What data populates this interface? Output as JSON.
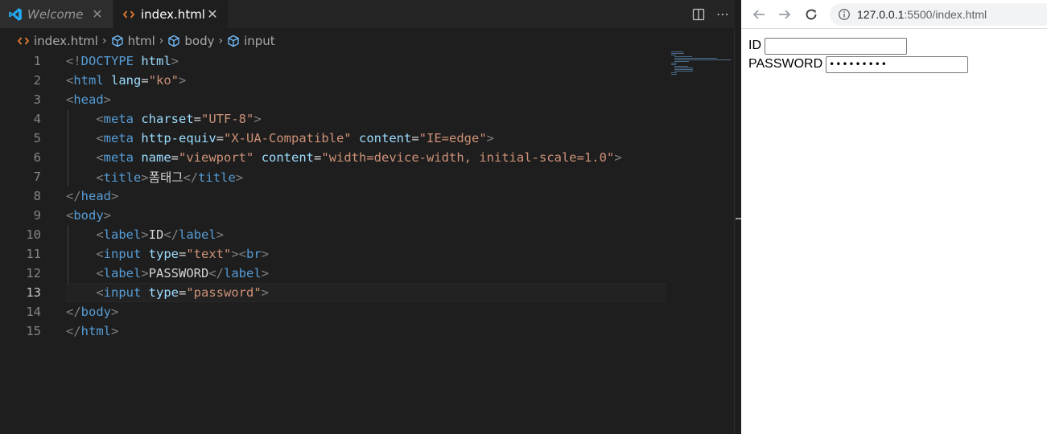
{
  "editor": {
    "tabs": [
      {
        "label": "Welcome",
        "active": false
      },
      {
        "label": "index.html",
        "active": true
      }
    ],
    "breadcrumb": [
      "index.html",
      "html",
      "body",
      "input"
    ],
    "current_line": 13,
    "lines": [
      {
        "n": "1",
        "segs": [
          [
            "b",
            "<!"
          ],
          [
            "t",
            "DOCTYPE "
          ],
          [
            "a",
            "html"
          ],
          [
            "b",
            ">"
          ]
        ]
      },
      {
        "n": "2",
        "segs": [
          [
            "b",
            "<"
          ],
          [
            "t",
            "html "
          ],
          [
            "a",
            "lang"
          ],
          [
            "x",
            "="
          ],
          [
            "s",
            "\"ko\""
          ],
          [
            "b",
            ">"
          ]
        ]
      },
      {
        "n": "3",
        "segs": [
          [
            "b",
            "<"
          ],
          [
            "t",
            "head"
          ],
          [
            "b",
            ">"
          ]
        ]
      },
      {
        "n": "4",
        "segs": [
          [
            "x",
            "    "
          ],
          [
            "b",
            "<"
          ],
          [
            "t",
            "meta "
          ],
          [
            "a",
            "charset"
          ],
          [
            "x",
            "="
          ],
          [
            "s",
            "\"UTF-8\""
          ],
          [
            "b",
            ">"
          ]
        ]
      },
      {
        "n": "5",
        "segs": [
          [
            "x",
            "    "
          ],
          [
            "b",
            "<"
          ],
          [
            "t",
            "meta "
          ],
          [
            "a",
            "http-equiv"
          ],
          [
            "x",
            "="
          ],
          [
            "s",
            "\"X-UA-Compatible\""
          ],
          [
            "x",
            " "
          ],
          [
            "a",
            "content"
          ],
          [
            "x",
            "="
          ],
          [
            "s",
            "\"IE=edge\""
          ],
          [
            "b",
            ">"
          ]
        ]
      },
      {
        "n": "6",
        "segs": [
          [
            "x",
            "    "
          ],
          [
            "b",
            "<"
          ],
          [
            "t",
            "meta "
          ],
          [
            "a",
            "name"
          ],
          [
            "x",
            "="
          ],
          [
            "s",
            "\"viewport\""
          ],
          [
            "x",
            " "
          ],
          [
            "a",
            "content"
          ],
          [
            "x",
            "="
          ],
          [
            "s",
            "\"width=device-width, initial-scale=1.0\""
          ],
          [
            "b",
            ">"
          ]
        ]
      },
      {
        "n": "7",
        "segs": [
          [
            "x",
            "    "
          ],
          [
            "b",
            "<"
          ],
          [
            "t",
            "title"
          ],
          [
            "b",
            ">"
          ],
          [
            "x",
            "폼태그"
          ],
          [
            "b",
            "</"
          ],
          [
            "t",
            "title"
          ],
          [
            "b",
            ">"
          ]
        ]
      },
      {
        "n": "8",
        "segs": [
          [
            "b",
            "</"
          ],
          [
            "t",
            "head"
          ],
          [
            "b",
            ">"
          ]
        ]
      },
      {
        "n": "9",
        "segs": [
          [
            "b",
            "<"
          ],
          [
            "t",
            "body"
          ],
          [
            "b",
            ">"
          ]
        ]
      },
      {
        "n": "10",
        "segs": [
          [
            "x",
            "    "
          ],
          [
            "b",
            "<"
          ],
          [
            "t",
            "label"
          ],
          [
            "b",
            ">"
          ],
          [
            "x",
            "ID"
          ],
          [
            "b",
            "</"
          ],
          [
            "t",
            "label"
          ],
          [
            "b",
            ">"
          ]
        ]
      },
      {
        "n": "11",
        "segs": [
          [
            "x",
            "    "
          ],
          [
            "b",
            "<"
          ],
          [
            "t",
            "input "
          ],
          [
            "a",
            "type"
          ],
          [
            "x",
            "="
          ],
          [
            "s",
            "\"text\""
          ],
          [
            "b",
            "><"
          ],
          [
            "t",
            "br"
          ],
          [
            "b",
            ">"
          ]
        ]
      },
      {
        "n": "12",
        "segs": [
          [
            "x",
            "    "
          ],
          [
            "b",
            "<"
          ],
          [
            "t",
            "label"
          ],
          [
            "b",
            ">"
          ],
          [
            "x",
            "PASSWORD"
          ],
          [
            "b",
            "</"
          ],
          [
            "t",
            "label"
          ],
          [
            "b",
            ">"
          ]
        ]
      },
      {
        "n": "13",
        "segs": [
          [
            "x",
            "    "
          ],
          [
            "b",
            "<"
          ],
          [
            "t",
            "input "
          ],
          [
            "a",
            "type"
          ],
          [
            "x",
            "="
          ],
          [
            "s",
            "\"password\""
          ],
          [
            "b",
            ">"
          ]
        ]
      },
      {
        "n": "14",
        "segs": [
          [
            "b",
            "</"
          ],
          [
            "t",
            "body"
          ],
          [
            "b",
            ">"
          ]
        ]
      },
      {
        "n": "15",
        "segs": [
          [
            "b",
            "</"
          ],
          [
            "t",
            "html"
          ],
          [
            "b",
            ">"
          ]
        ]
      }
    ]
  },
  "browser": {
    "url_host": "127.0.0.1",
    "url_rest": ":5500/index.html",
    "id_label": "ID",
    "id_value": "",
    "password_label": "PASSWORD",
    "password_value": "•••••••••"
  },
  "colors": {
    "vscode_blue": "#23a9f2",
    "html_icon_orange": "#e37933",
    "cube_icon_blue": "#75beff"
  }
}
